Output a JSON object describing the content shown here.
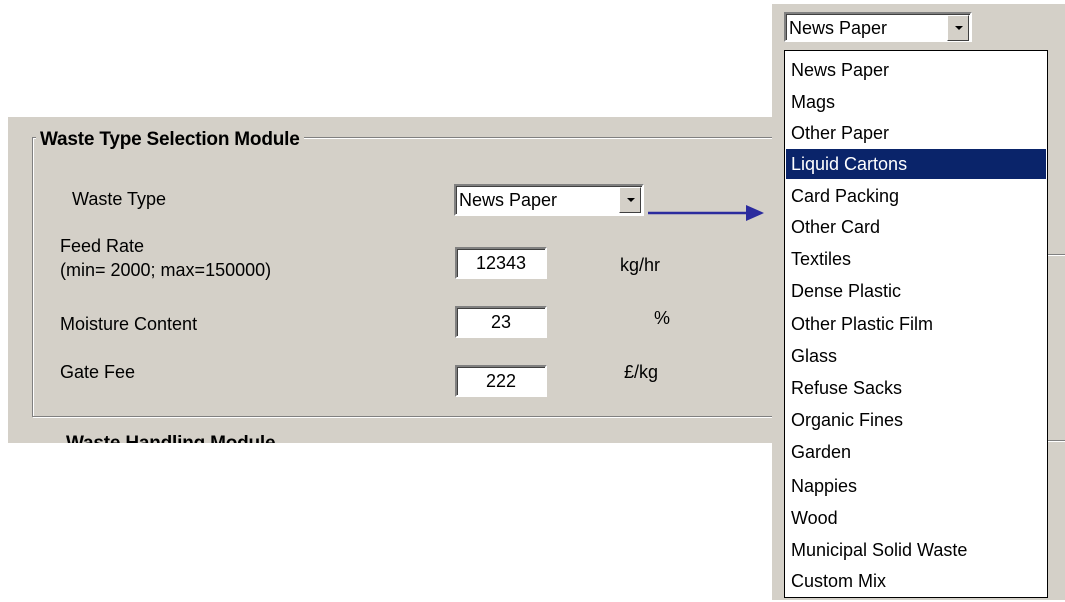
{
  "panel": {
    "group_title": "Waste Type Selection Module",
    "next_title": "Waste Handling Module",
    "waste_type_label": "Waste Type",
    "waste_type_value": "News Paper",
    "feed_rate_label": "Feed Rate",
    "feed_rate_range": "(min= 2000; max=150000)",
    "feed_rate_value": "12343",
    "feed_rate_unit": "kg/hr",
    "moisture_label": "Moisture Content",
    "moisture_value": "23",
    "moisture_unit": "%",
    "gate_fee_label": "Gate Fee",
    "gate_fee_value": "222",
    "gate_fee_unit": "£/kg"
  },
  "dropdown": {
    "selected": "News Paper",
    "highlighted": "Liquid Cartons",
    "options": [
      "News Paper",
      "Mags",
      "Other Paper",
      "Liquid Cartons",
      "Card Packing",
      "Other Card",
      "Textiles",
      "Dense Plastic",
      "Other Plastic Film",
      "Glass",
      "Refuse Sacks",
      "Organic Fines",
      "Garden",
      "Nappies",
      "Wood",
      "Municipal Solid Waste",
      "Custom Mix"
    ]
  },
  "colors": {
    "dialog_bg": "#d4d0c8",
    "highlight_bg": "#0a246a",
    "arrow": "#2b2b9e"
  },
  "icons": {
    "combo_button": "chevron-down-icon",
    "connector": "arrow-right-icon"
  }
}
